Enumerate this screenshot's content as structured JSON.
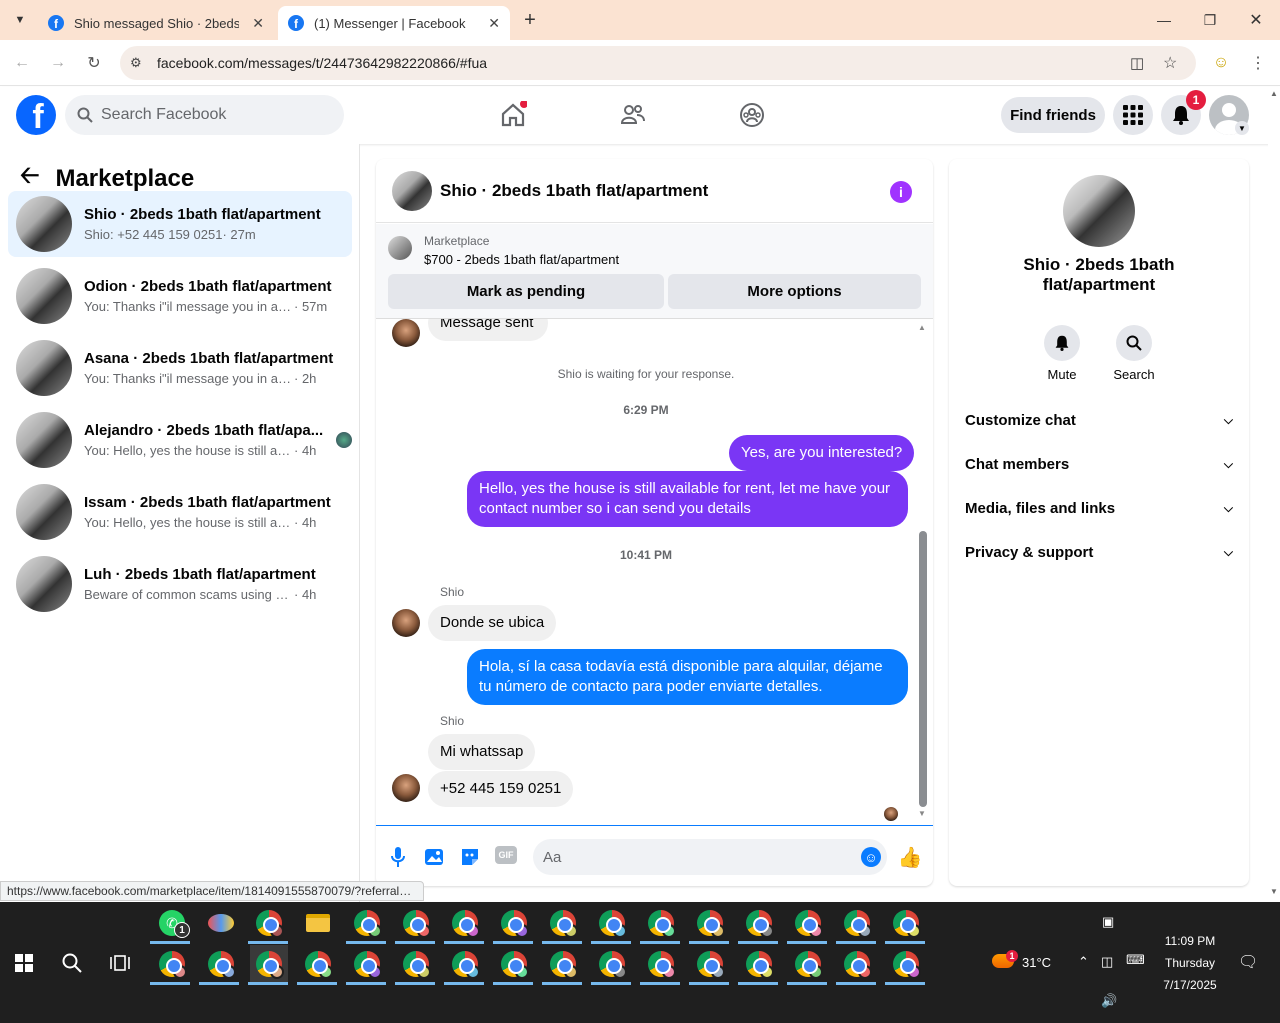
{
  "browser": {
    "tabs": [
      {
        "title": "Shio messaged Shio · 2beds 1b..."
      },
      {
        "title": "(1) Messenger | Facebook"
      }
    ],
    "url": "facebook.com/messages/t/24473642982220866/#fua"
  },
  "fb_header": {
    "search_placeholder": "Search Facebook",
    "find_friends": "Find friends",
    "notification_count": "1"
  },
  "sidebar": {
    "title": "Marketplace",
    "conversations": [
      {
        "name": "Shio · 2beds 1bath flat/apartment",
        "preview": "Shio: +52 445 159 0251",
        "time": "· 27m"
      },
      {
        "name": "Odion · 2beds 1bath flat/apartment",
        "preview": "You: Thanks i\"il message you in a m...",
        "time": "· 57m"
      },
      {
        "name": "Asana · 2beds 1bath flat/apartment",
        "preview": "You: Thanks i\"il message you in a mo...",
        "time": "· 2h"
      },
      {
        "name": "Alejandro · 2beds 1bath flat/apa...",
        "preview": "You: Hello, yes the house is still ava...",
        "time": "· 4h"
      },
      {
        "name": "Issam · 2beds 1bath flat/apartment",
        "preview": "You: Hello, yes the house is still availa...",
        "time": "· 4h"
      },
      {
        "name": "Luh · 2beds 1bath flat/apartment",
        "preview": "Beware of common scams using pay...",
        "time": "· 4h"
      }
    ]
  },
  "chat": {
    "title": "Shio · 2beds 1bath flat/apartment",
    "marketplace_label": "Marketplace",
    "listing": "$700 - 2beds 1bath flat/apartment",
    "mark_pending": "Mark as pending",
    "more_options": "More options",
    "partial_msg": "Message sent",
    "waiting": "Shio is waiting for your response.",
    "time1": "6:29 PM",
    "out1": "Yes, are you interested?",
    "out2": "Hello, yes the house is still available for rent, let me have your contact number so i can send you details",
    "time2": "10:41 PM",
    "sender": "Shio",
    "in1": "Donde se ubica",
    "out3": "Hola, sí la casa todavía está disponible para alquilar, déjame tu número de contacto para poder enviarte detalles.",
    "in2": "Mi whatssap",
    "in3": "+52 445 159 0251",
    "input_placeholder": "Aa",
    "gif_label": "GIF"
  },
  "details": {
    "name": "Shio · 2beds 1bath flat/apartment",
    "mute": "Mute",
    "search": "Search",
    "sections": [
      "Customize chat",
      "Chat members",
      "Media, files and links",
      "Privacy & support"
    ]
  },
  "status_url": "https://www.facebook.com/marketplace/item/1814091555870079/?referralS...",
  "taskbar": {
    "whatsapp_badge": "1",
    "weather_badge": "1",
    "temperature": "31°C",
    "time": "11:09 PM",
    "day": "Thursday",
    "date": "7/17/2025"
  },
  "colors": {
    "fb_blue": "#0866ff",
    "outgoing_blue": "#0a7cff",
    "outgoing_purple": "#7a36f5",
    "tabstrip": "#fbe3d2"
  }
}
